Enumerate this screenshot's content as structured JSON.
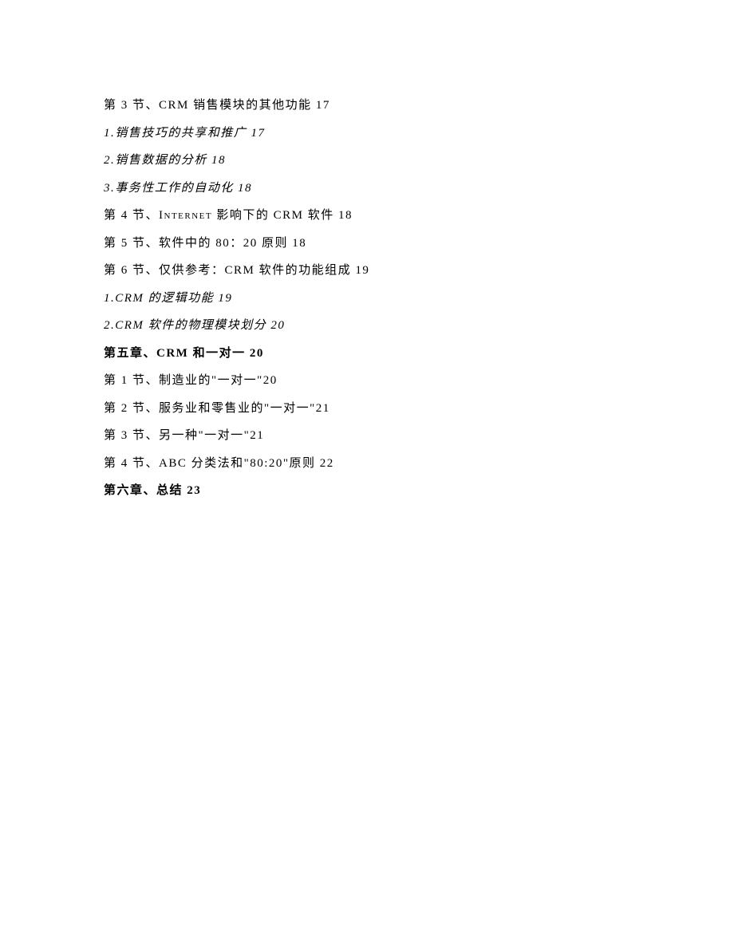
{
  "lines": [
    {
      "text": "第 3 节、CRM 销售模块的其他功能 17",
      "style": "normal"
    },
    {
      "text": "1.销售技巧的共享和推广 17",
      "style": "italic"
    },
    {
      "text": "2.销售数据的分析 18",
      "style": "italic"
    },
    {
      "text": "3.事务性工作的自动化 18",
      "style": "italic"
    },
    {
      "text": "第 4 节、INTERNET 影响下的 CRM 软件 18",
      "style": "normal-sc"
    },
    {
      "text": "第 5 节、软件中的 80：20 原则 18",
      "style": "normal"
    },
    {
      "text": "第 6 节、仅供参考：CRM 软件的功能组成 19",
      "style": "normal"
    },
    {
      "text": "1.CRM 的逻辑功能 19",
      "style": "italic"
    },
    {
      "text": "2.CRM 软件的物理模块划分 20",
      "style": "italic"
    },
    {
      "text": "第五章、CRM 和一对一 20",
      "style": "bold"
    },
    {
      "text": "第 1 节、制造业的\"一对一\"20",
      "style": "normal"
    },
    {
      "text": "第 2 节、服务业和零售业的\"一对一\"21",
      "style": "normal"
    },
    {
      "text": "第 3 节、另一种\"一对一\"21",
      "style": "normal"
    },
    {
      "text": "第 4 节、ABC 分类法和\"80:20\"原则 22",
      "style": "normal"
    },
    {
      "text": "第六章、总结 23",
      "style": "bold"
    }
  ]
}
